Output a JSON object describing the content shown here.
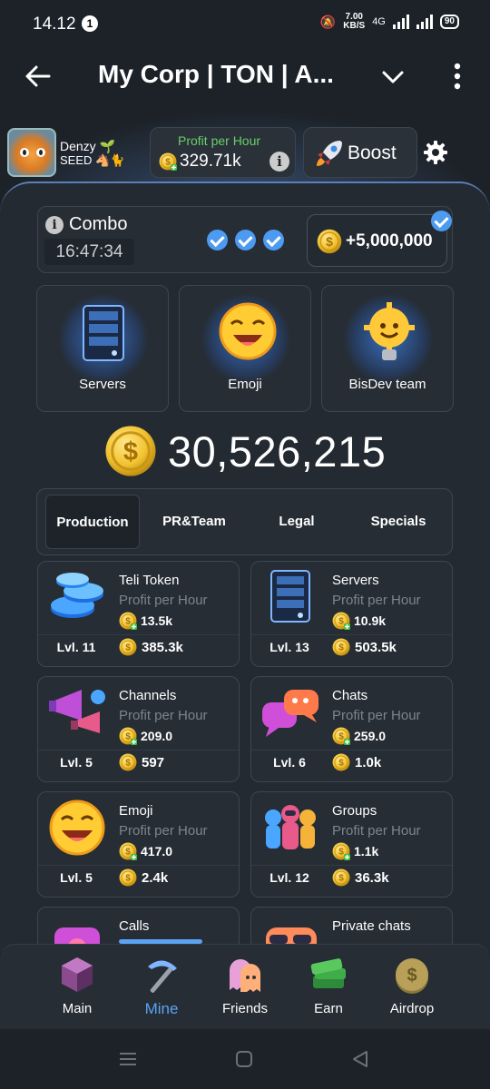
{
  "status_bar": {
    "time": "14.12",
    "notification_count": "1",
    "speed_value": "7.00",
    "speed_unit": "KB/S",
    "network": "4G",
    "battery": "90"
  },
  "titlebar": {
    "title": "My Corp | TON | A..."
  },
  "header": {
    "user_name": "Denzy 🌱",
    "user_level": "SEED 🐴🐈",
    "profit_label": "Profit per Hour",
    "profit_value": "329.71k",
    "info_glyph": "i",
    "boost_label": "Boost"
  },
  "combo": {
    "info_glyph": "i",
    "label": "Combo",
    "timer": "16:47:34",
    "reward": "+5,000,000",
    "cards": [
      {
        "label": "Servers"
      },
      {
        "label": "Emoji"
      },
      {
        "label": "BisDev team"
      }
    ]
  },
  "balance": "30,526,215",
  "tabs": [
    "Production",
    "PR&Team",
    "Legal",
    "Specials"
  ],
  "upgrades": [
    {
      "name": "Teli Token",
      "sub": "Profit per Hour",
      "pph": "13.5k",
      "level": "Lvl. 11",
      "cost": "385.3k"
    },
    {
      "name": "Servers",
      "sub": "Profit per Hour",
      "pph": "10.9k",
      "level": "Lvl. 13",
      "cost": "503.5k"
    },
    {
      "name": "Channels",
      "sub": "Profit per Hour",
      "pph": "209.0",
      "level": "Lvl. 5",
      "cost": "597"
    },
    {
      "name": "Chats",
      "sub": "Profit per Hour",
      "pph": "259.0",
      "level": "Lvl. 6",
      "cost": "1.0k"
    },
    {
      "name": "Emoji",
      "sub": "Profit per Hour",
      "pph": "417.0",
      "level": "Lvl. 5",
      "cost": "2.4k"
    },
    {
      "name": "Groups",
      "sub": "Profit per Hour",
      "pph": "1.1k",
      "level": "Lvl. 12",
      "cost": "36.3k"
    },
    {
      "name": "Calls"
    },
    {
      "name": "Private chats"
    }
  ],
  "nav": [
    "Main",
    "Mine",
    "Friends",
    "Earn",
    "Airdrop"
  ],
  "colors": {
    "accent": "#5aa2f2",
    "profit_green": "#6ad06a",
    "check_blue": "#4c9bf0",
    "coin_gold": "#f2c230",
    "background": "#1d2228",
    "card": "#262d35"
  },
  "icons": [
    "back-arrow-icon",
    "chevron-down-icon",
    "more-vert-icon",
    "rocket-icon",
    "gear-icon",
    "info-icon",
    "check-icon",
    "coin-icon"
  ]
}
